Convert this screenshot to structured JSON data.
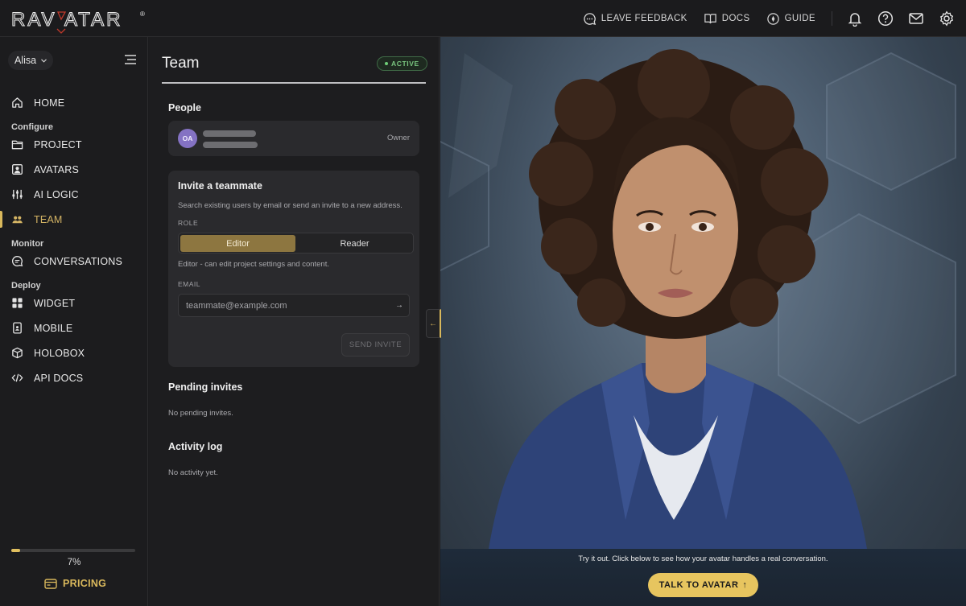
{
  "app": {
    "logo_text": "RAVATAR"
  },
  "topbar": {
    "feedback_label": "LEAVE FEEDBACK",
    "docs_label": "DOCS",
    "guide_label": "GUIDE"
  },
  "sidebar": {
    "user_name": "Alisa",
    "items": [
      {
        "label": "HOME",
        "icon": "home-icon"
      },
      {
        "section": "Configure"
      },
      {
        "label": "PROJECT",
        "icon": "folder-icon"
      },
      {
        "label": "AVATARS",
        "icon": "avatar-icon"
      },
      {
        "label": "AI LOGIC",
        "icon": "sliders-icon"
      },
      {
        "label": "TEAM",
        "icon": "team-icon",
        "active": true
      },
      {
        "section": "Monitor"
      },
      {
        "label": "CONVERSATIONS",
        "icon": "chat-icon"
      },
      {
        "section": "Deploy"
      },
      {
        "label": "WIDGET",
        "icon": "widget-icon"
      },
      {
        "label": "MOBILE",
        "icon": "mobile-icon"
      },
      {
        "label": "HOLOBOX",
        "icon": "box-icon"
      },
      {
        "label": "API DOCS",
        "icon": "code-icon"
      }
    ],
    "usage_percent": 7,
    "usage_label": "7%",
    "pricing_label": "PRICING"
  },
  "team": {
    "title": "Team",
    "status": "ACTIVE",
    "people_title": "People",
    "member": {
      "initials": "OA",
      "role": "Owner"
    },
    "invite": {
      "title": "Invite a teammate",
      "subtitle": "Search existing users by email or send an invite to a new address.",
      "role_label": "ROLE",
      "roles": [
        "Editor",
        "Reader"
      ],
      "selected_role": "Editor",
      "role_hint": "Editor - can edit project settings and content.",
      "email_label": "EMAIL",
      "email_placeholder": "teammate@example.com",
      "send_label": "SEND INVITE"
    },
    "pending_title": "Pending invites",
    "pending_empty": "No pending invites.",
    "activity_title": "Activity log",
    "activity_empty": "No activity yet."
  },
  "preview": {
    "try_text": "Try it out. Click below to see how your avatar handles a real conversation.",
    "talk_label": "TALK TO AVATAR"
  },
  "colors": {
    "accent": "#d9b85c",
    "active_green": "#6fcf78",
    "member_avatar": "#8472c3"
  }
}
